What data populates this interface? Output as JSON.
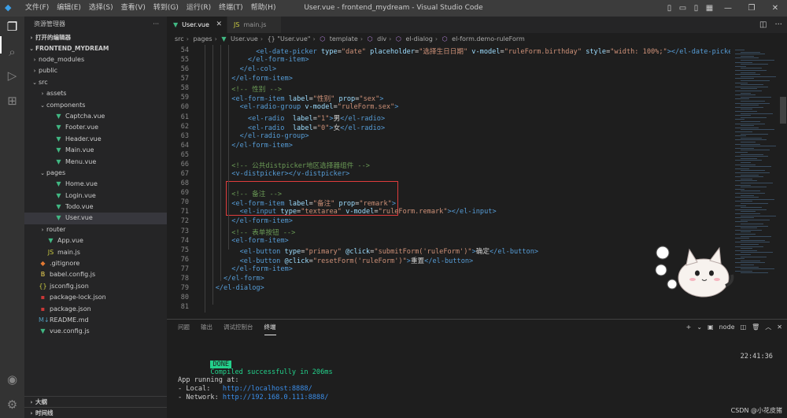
{
  "window": {
    "title": "User.vue - frontend_mydream - Visual Studio Code",
    "menu": [
      "文件(F)",
      "编辑(E)",
      "选择(S)",
      "查看(V)",
      "转到(G)",
      "运行(R)",
      "终端(T)",
      "帮助(H)"
    ]
  },
  "sidebar": {
    "header": "资源管理器",
    "open_editors": "打开的编辑器",
    "project": "FRONTEND_MYDREAM",
    "tree": [
      {
        "label": "node_modules",
        "depth": 1,
        "kind": "folder",
        "expanded": false,
        "icon": "folder-icon"
      },
      {
        "label": "public",
        "depth": 1,
        "kind": "folder",
        "expanded": false,
        "icon": "folder-icon"
      },
      {
        "label": "src",
        "depth": 1,
        "kind": "folder",
        "expanded": true,
        "icon": "folder-icon"
      },
      {
        "label": "assets",
        "depth": 2,
        "kind": "folder",
        "expanded": false,
        "icon": "folder-icon"
      },
      {
        "label": "components",
        "depth": 2,
        "kind": "folder",
        "expanded": true,
        "icon": "folder-icon"
      },
      {
        "label": "Captcha.vue",
        "depth": 3,
        "kind": "vue",
        "icon": "vue-file-icon"
      },
      {
        "label": "Footer.vue",
        "depth": 3,
        "kind": "vue",
        "icon": "vue-file-icon"
      },
      {
        "label": "Header.vue",
        "depth": 3,
        "kind": "vue",
        "icon": "vue-file-icon"
      },
      {
        "label": "Main.vue",
        "depth": 3,
        "kind": "vue",
        "icon": "vue-file-icon"
      },
      {
        "label": "Menu.vue",
        "depth": 3,
        "kind": "vue",
        "icon": "vue-file-icon"
      },
      {
        "label": "pages",
        "depth": 2,
        "kind": "folder",
        "expanded": true,
        "icon": "folder-icon"
      },
      {
        "label": "Home.vue",
        "depth": 3,
        "kind": "vue",
        "icon": "vue-file-icon"
      },
      {
        "label": "Login.vue",
        "depth": 3,
        "kind": "vue",
        "icon": "vue-file-icon"
      },
      {
        "label": "Todo.vue",
        "depth": 3,
        "kind": "vue",
        "icon": "vue-file-icon"
      },
      {
        "label": "User.vue",
        "depth": 3,
        "kind": "vue",
        "icon": "vue-file-icon",
        "selected": true
      },
      {
        "label": "router",
        "depth": 2,
        "kind": "folder",
        "expanded": false,
        "icon": "folder-icon"
      },
      {
        "label": "App.vue",
        "depth": 2,
        "kind": "vue",
        "icon": "vue-file-icon"
      },
      {
        "label": "main.js",
        "depth": 2,
        "kind": "js",
        "icon": "js-file-icon"
      },
      {
        "label": ".gitignore",
        "depth": 1,
        "kind": "git",
        "icon": "git-file-icon"
      },
      {
        "label": "babel.config.js",
        "depth": 1,
        "kind": "babel",
        "icon": "babel-file-icon"
      },
      {
        "label": "jsconfig.json",
        "depth": 1,
        "kind": "json",
        "icon": "json-file-icon"
      },
      {
        "label": "package-lock.json",
        "depth": 1,
        "kind": "npm",
        "icon": "npm-file-icon"
      },
      {
        "label": "package.json",
        "depth": 1,
        "kind": "npm",
        "icon": "npm-file-icon"
      },
      {
        "label": "README.md",
        "depth": 1,
        "kind": "md",
        "icon": "markdown-file-icon"
      },
      {
        "label": "vue.config.js",
        "depth": 1,
        "kind": "vue",
        "icon": "vue-file-icon"
      }
    ],
    "outline": "大纲",
    "timeline": "时间线"
  },
  "tabs": [
    {
      "label": "User.vue",
      "active": true
    },
    {
      "label": "main.js",
      "active": false
    }
  ],
  "breadcrumb": [
    "src",
    "pages",
    "User.vue",
    "{} \"User.vue\"",
    "template",
    "div",
    "el-dialog",
    "el-form.demo-ruleForm"
  ],
  "code": {
    "lines": [
      {
        "n": "54",
        "indent": 4,
        "segs": [
          [
            "t",
            "<el-date-picker "
          ],
          [
            "a",
            "type"
          ],
          [
            "w",
            "="
          ],
          [
            "s",
            "\"date\" "
          ],
          [
            "a",
            "placeholder"
          ],
          [
            "w",
            "="
          ],
          [
            "s",
            "\"选择生日日期\" "
          ],
          [
            "a",
            "v-model"
          ],
          [
            "w",
            "="
          ],
          [
            "s",
            "\"ruleForm.birthday\" "
          ],
          [
            "a",
            "style"
          ],
          [
            "w",
            "="
          ],
          [
            "s",
            "\"width: 100%;\""
          ],
          [
            "t",
            "></el-date-picker>"
          ]
        ]
      },
      {
        "n": "55",
        "indent": 3,
        "segs": [
          [
            "t",
            "</el-form-item>"
          ]
        ]
      },
      {
        "n": "56",
        "indent": 2,
        "segs": [
          [
            "t",
            "</el-col>"
          ]
        ]
      },
      {
        "n": "57",
        "indent": 1,
        "segs": [
          [
            "t",
            "</el-form-item>"
          ]
        ]
      },
      {
        "n": "58",
        "indent": 1,
        "segs": [
          [
            "c",
            "<!-- 性别 -->"
          ]
        ]
      },
      {
        "n": "59",
        "indent": 1,
        "segs": [
          [
            "t",
            "<el-form-item "
          ],
          [
            "a",
            "label"
          ],
          [
            "w",
            "="
          ],
          [
            "s",
            "\"性别\" "
          ],
          [
            "a",
            "prop"
          ],
          [
            "w",
            "="
          ],
          [
            "s",
            "\"sex\""
          ],
          [
            "t",
            ">"
          ]
        ]
      },
      {
        "n": "60",
        "indent": 2,
        "segs": [
          [
            "t",
            "<el-radio-group "
          ],
          [
            "a",
            "v-model"
          ],
          [
            "w",
            "="
          ],
          [
            "s",
            "\"ruleForm.sex\""
          ],
          [
            "t",
            ">"
          ]
        ]
      },
      {
        "n": "61",
        "indent": 3,
        "segs": [
          [
            "t",
            "<el-radio  "
          ],
          [
            "a",
            "label"
          ],
          [
            "w",
            "="
          ],
          [
            "s",
            "\"1\""
          ],
          [
            "t",
            ">"
          ],
          [
            "w",
            "男"
          ],
          [
            "t",
            "</el-radio>"
          ]
        ]
      },
      {
        "n": "62",
        "indent": 3,
        "segs": [
          [
            "t",
            "<el-radio  "
          ],
          [
            "a",
            "label"
          ],
          [
            "w",
            "="
          ],
          [
            "s",
            "\"0\""
          ],
          [
            "t",
            ">"
          ],
          [
            "w",
            "女"
          ],
          [
            "t",
            "</el-radio>"
          ]
        ]
      },
      {
        "n": "63",
        "indent": 2,
        "segs": [
          [
            "t",
            "</el-radio-group>"
          ]
        ]
      },
      {
        "n": "64",
        "indent": 1,
        "segs": [
          [
            "t",
            "</el-form-item>"
          ]
        ]
      },
      {
        "n": "65",
        "indent": 1,
        "segs": []
      },
      {
        "n": "66",
        "indent": 1,
        "segs": [
          [
            "c",
            "<!-- 公共distpicker地区选择器组件 -->"
          ]
        ]
      },
      {
        "n": "67",
        "indent": 1,
        "segs": [
          [
            "t",
            "<v-distpicker></v-distpicker>"
          ]
        ]
      },
      {
        "n": "68",
        "indent": 1,
        "segs": []
      },
      {
        "n": "69",
        "indent": 1,
        "segs": [
          [
            "c",
            "<!-- 备注 -->"
          ]
        ]
      },
      {
        "n": "70",
        "indent": 1,
        "segs": [
          [
            "t",
            "<el-form-item "
          ],
          [
            "a",
            "label"
          ],
          [
            "w",
            "="
          ],
          [
            "s",
            "\"备注\" "
          ],
          [
            "a",
            "prop"
          ],
          [
            "w",
            "="
          ],
          [
            "s",
            "\"remark\""
          ],
          [
            "t",
            ">"
          ]
        ]
      },
      {
        "n": "71",
        "indent": 2,
        "segs": [
          [
            "t",
            "<el-input "
          ],
          [
            "a",
            "type"
          ],
          [
            "w",
            "="
          ],
          [
            "s",
            "\"textarea\" "
          ],
          [
            "a",
            "v-model"
          ],
          [
            "w",
            "="
          ],
          [
            "s",
            "\"ruleForm.remark\""
          ],
          [
            "t",
            "></el-input>"
          ]
        ]
      },
      {
        "n": "72",
        "indent": 1,
        "segs": [
          [
            "t",
            "</el-form-item>"
          ]
        ]
      },
      {
        "n": "73",
        "indent": 1,
        "segs": [
          [
            "c",
            "<!-- 表单按钮 -->"
          ]
        ]
      },
      {
        "n": "74",
        "indent": 1,
        "segs": [
          [
            "t",
            "<el-form-item>"
          ]
        ]
      },
      {
        "n": "75",
        "indent": 2,
        "segs": [
          [
            "t",
            "<el-button "
          ],
          [
            "a",
            "type"
          ],
          [
            "w",
            "="
          ],
          [
            "s",
            "\"primary\" "
          ],
          [
            "a",
            "@click"
          ],
          [
            "w",
            "="
          ],
          [
            "s",
            "\"submitForm('ruleForm')\""
          ],
          [
            "t",
            ">"
          ],
          [
            "w",
            "确定"
          ],
          [
            "t",
            "</el-button>"
          ]
        ]
      },
      {
        "n": "76",
        "indent": 2,
        "segs": [
          [
            "t",
            "<el-button "
          ],
          [
            "a",
            "@click"
          ],
          [
            "w",
            "="
          ],
          [
            "s",
            "\"resetForm('ruleForm')\""
          ],
          [
            "t",
            ">"
          ],
          [
            "w",
            "重置"
          ],
          [
            "t",
            "</el-button>"
          ]
        ]
      },
      {
        "n": "77",
        "indent": 1,
        "segs": [
          [
            "t",
            "</el-form-item>"
          ]
        ]
      },
      {
        "n": "78",
        "indent": 0,
        "segs": [
          [
            "t",
            "</el-form>"
          ]
        ]
      },
      {
        "n": "79",
        "indent": -1,
        "segs": [
          [
            "t",
            "</el-dialog>"
          ]
        ]
      },
      {
        "n": "80",
        "indent": -1,
        "segs": []
      },
      {
        "n": "81",
        "indent": -1,
        "segs": []
      }
    ]
  },
  "panel": {
    "tabs": [
      "问题",
      "输出",
      "调试控制台",
      "终端"
    ],
    "active_tab": "终端",
    "shell": "node",
    "done_badge": "DONE",
    "compiled": "Compiled successfully in 206ms",
    "time": "22:41:36",
    "app_running": "App running at:",
    "local_label": "- Local:   ",
    "local_url": "http://localhost:8888/",
    "network_label": "- Network: ",
    "network_url": "http://192.168.0.111:8888/"
  },
  "watermark": "CSDN @小花皮猪",
  "colors": {
    "accent": "#007acc",
    "done_badge": "#23d18b",
    "highlight_box": "#e03c3c"
  }
}
